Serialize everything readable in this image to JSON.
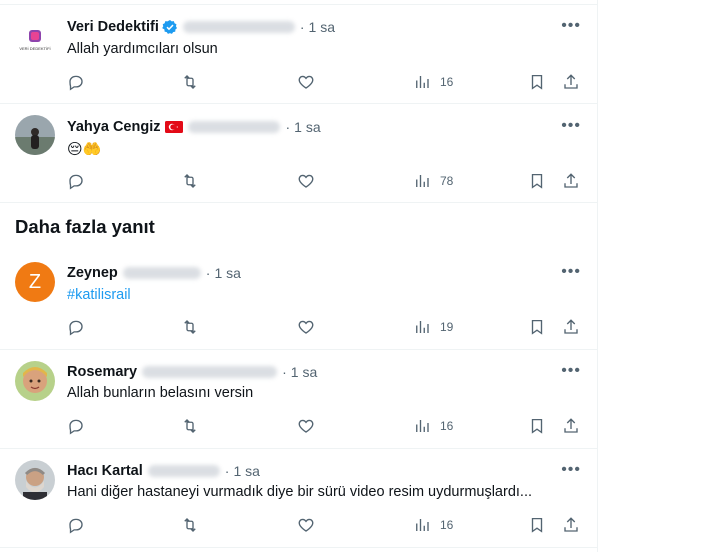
{
  "replies_top": [
    {
      "name": "Veri Dedektifi",
      "verified": true,
      "time": "1 sa",
      "text": "Allah yardımcıları olsun",
      "views": "16",
      "avatar_text": "VERİ DEDEKTİFİ"
    },
    {
      "name": "Yahya Cengiz",
      "flag": "tr-flag-icon",
      "time": "1 sa",
      "text": "😔🤲",
      "views": "78"
    }
  ],
  "more_replies_title": "Daha fazla yanıt",
  "replies_more": [
    {
      "name": "Zeynep",
      "time": "1 sa",
      "text": "#katilisrail",
      "avatar_letter": "Z",
      "views": "19"
    },
    {
      "name": "Rosemary",
      "time": "1 sa",
      "text": "Allah bunların belasını versin",
      "views": "16"
    },
    {
      "name": "Hacı Kartal",
      "time": "1 sa",
      "text": "Hani diğer hastaneyi vurmadık diye bir sürü video resim uydurmuşlardı...",
      "views": "16"
    }
  ],
  "colors": {
    "accent": "#1d9bf0",
    "secondary_text": "#536471",
    "divider": "#eff3f4"
  }
}
